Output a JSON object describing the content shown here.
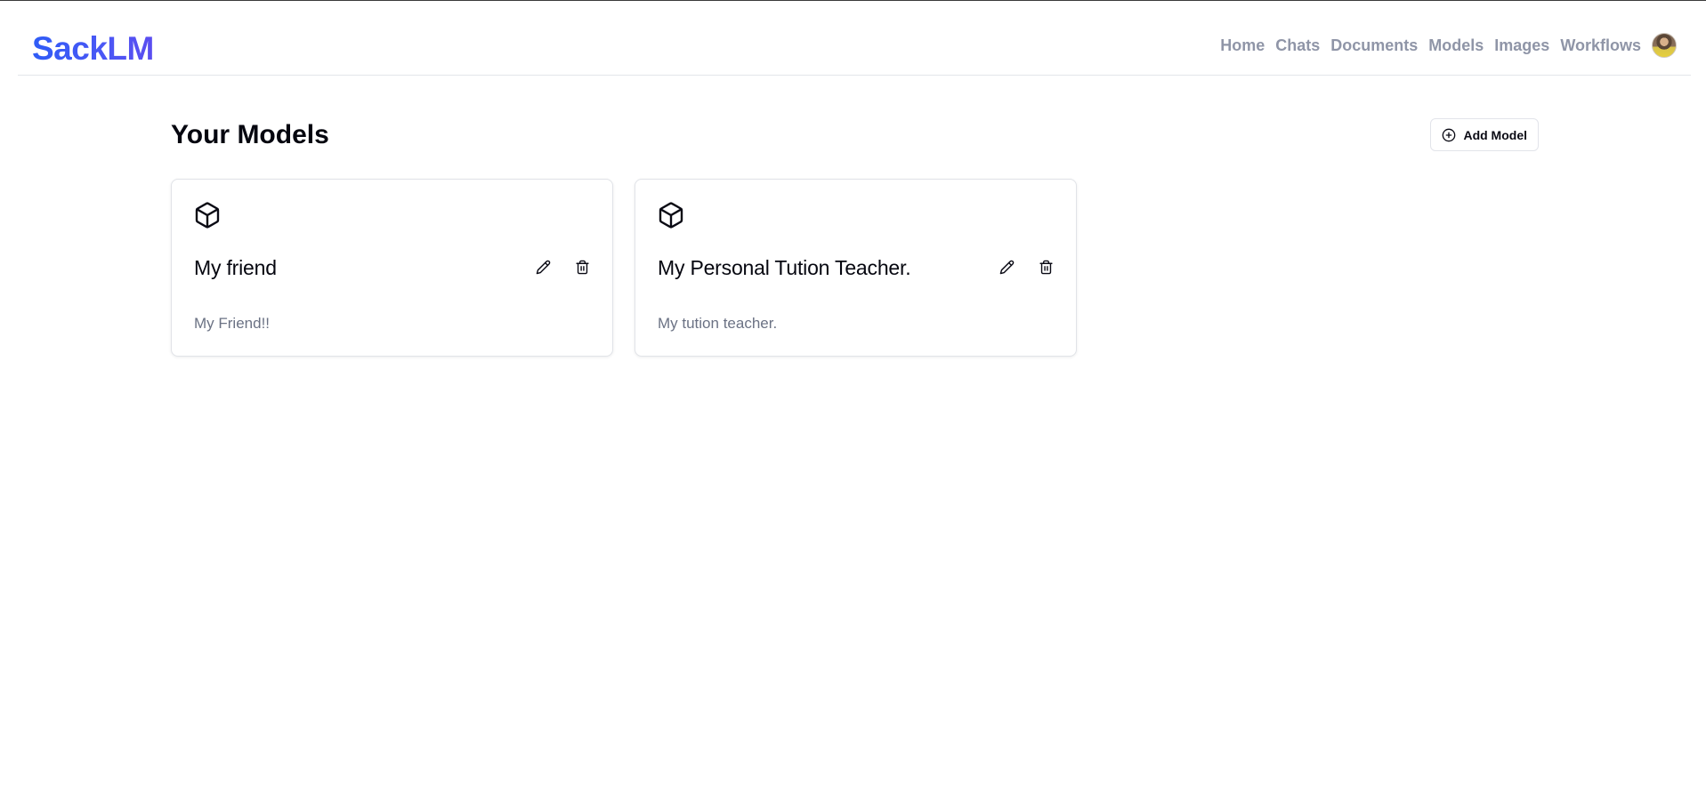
{
  "app": {
    "brand": "SackLM"
  },
  "nav": {
    "items": [
      {
        "label": "Home"
      },
      {
        "label": "Chats"
      },
      {
        "label": "Documents"
      },
      {
        "label": "Models"
      },
      {
        "label": "Images"
      },
      {
        "label": "Workflows"
      }
    ],
    "avatar_icon": "user-avatar"
  },
  "page": {
    "title": "Your Models",
    "add_button": {
      "label": "Add Model",
      "icon": "plus-circle-icon"
    }
  },
  "models": [
    {
      "icon": "cube-icon",
      "name": "My friend",
      "description": "My Friend!!",
      "actions": [
        "pencil-icon",
        "trash-icon"
      ]
    },
    {
      "icon": "cube-icon",
      "name": "My Personal Tution Teacher.",
      "description": "My tution teacher.",
      "actions": [
        "pencil-icon",
        "trash-icon"
      ]
    }
  ],
  "colors": {
    "brand": "#3b5bfa",
    "nav_text": "#8f95a7",
    "muted_text": "#6b7284",
    "border": "#e1e3e8"
  }
}
